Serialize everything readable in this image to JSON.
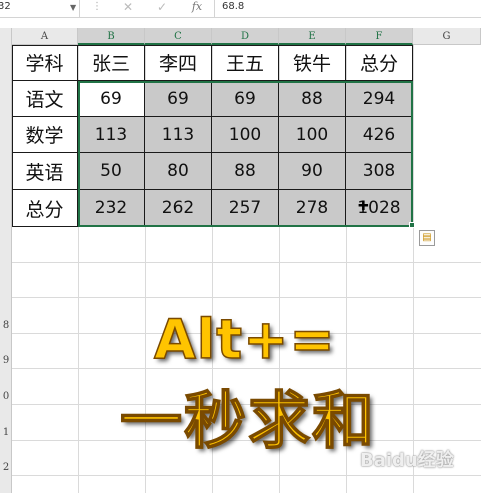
{
  "formula_bar": {
    "name_box": "32",
    "cancel_icon": "✕",
    "confirm_icon": "✓",
    "fx_label": "fx",
    "formula_value": "68.8"
  },
  "columns": [
    "A",
    "B",
    "C",
    "D",
    "E",
    "F",
    "G"
  ],
  "rows": [
    "",
    "",
    "",
    "",
    "",
    "",
    "",
    "",
    "8",
    "9",
    "0",
    "1",
    "2"
  ],
  "table": {
    "header": [
      "学科",
      "张三",
      "李四",
      "王五",
      "铁牛",
      "总分"
    ],
    "body": [
      [
        "语文",
        "69",
        "69",
        "69",
        "88",
        "294"
      ],
      [
        "数学",
        "113",
        "113",
        "100",
        "100",
        "426"
      ],
      [
        "英语",
        "50",
        "80",
        "88",
        "90",
        "308"
      ],
      [
        "总分",
        "232",
        "262",
        "257",
        "278",
        "1028"
      ]
    ]
  },
  "overlay": {
    "line1": "Alt+=",
    "line2": "一秒求和"
  },
  "watermark": "Baidu经验",
  "colors": {
    "accent": "#217346",
    "selection_fill": "#c9c9c9",
    "overlay_text": "#ffc400"
  },
  "icons": {
    "quick_analysis": "quick-analysis-icon",
    "cursor": "cell-cursor-icon"
  }
}
